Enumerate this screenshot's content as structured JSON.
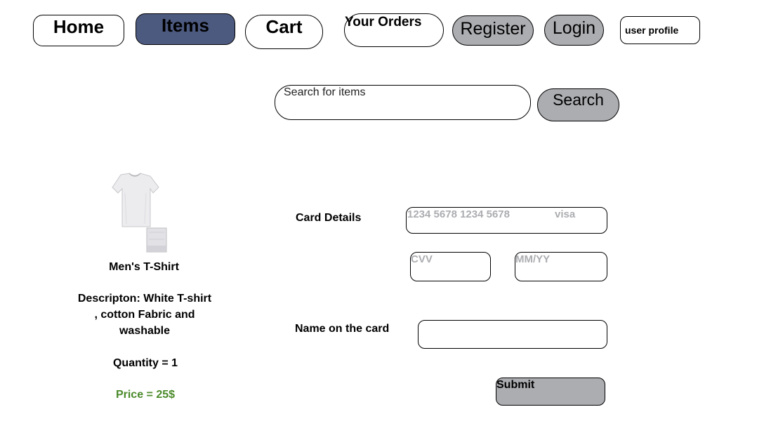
{
  "nav": {
    "home": "Home",
    "items": "Items",
    "cart": "Cart",
    "orders": "Your Orders",
    "register": "Register",
    "login": "Login",
    "profile": "user profile"
  },
  "search": {
    "placeholder": "Search for items",
    "button_label": "Search"
  },
  "product": {
    "name": "Men's  T-Shirt",
    "description_line1": "Descripton: White T-shirt",
    "description_line2": ", cotton Fabric and",
    "description_line3": "washable",
    "quantity": "Quantity = 1",
    "price": "Price = 25$",
    "price_color": "#4a8a2a"
  },
  "payment": {
    "card_details_label": "Card Details",
    "card_number_placeholder": "1234 5678 1234 5678",
    "card_type": "visa",
    "cvv_placeholder": "CVV",
    "expiry_placeholder": "MM/YY",
    "name_label": "Name on the card",
    "name_value": "",
    "submit_label": "Submit"
  },
  "colors": {
    "active_tab": "#4d5a80",
    "gray_button": "#acadb1",
    "placeholder_gray": "#acadb1"
  }
}
